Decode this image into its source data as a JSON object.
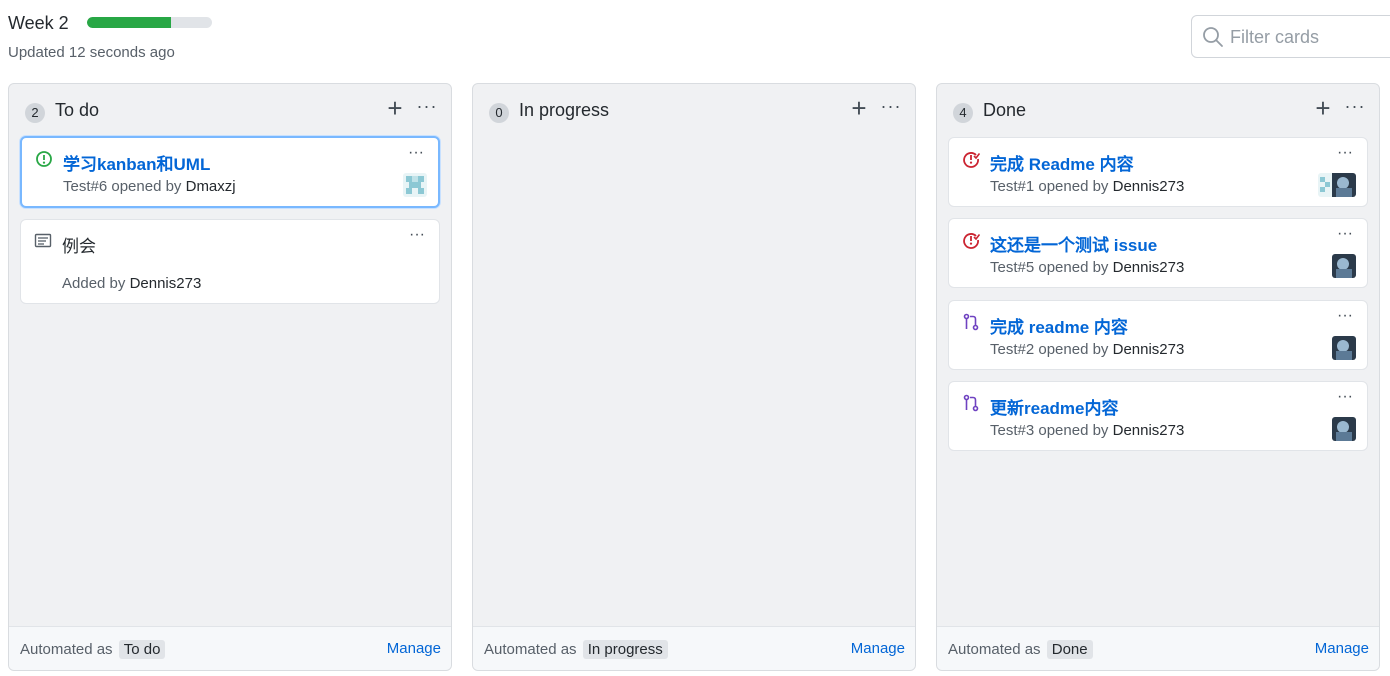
{
  "board": {
    "title": "Week 2",
    "progress": 0.67,
    "updated": "Updated 12 seconds ago",
    "filter_placeholder": "Filter cards"
  },
  "columns": [
    {
      "count": "2",
      "title": "To do",
      "automated_label": "Automated as",
      "automated_value": "To do",
      "manage": "Manage",
      "cards": [
        {
          "type": "issue-open",
          "title": "学习kanban和UML",
          "meta_prefix": "Test#6 opened by",
          "author": "Dmaxzj"
        },
        {
          "type": "note",
          "title": "例会",
          "meta_prefix": "Added by",
          "author": "Dennis273"
        }
      ]
    },
    {
      "count": "0",
      "title": "In progress",
      "automated_label": "Automated as",
      "automated_value": "In progress",
      "manage": "Manage",
      "cards": []
    },
    {
      "count": "4",
      "title": "Done",
      "automated_label": "Automated as",
      "automated_value": "Done",
      "manage": "Manage",
      "cards": [
        {
          "type": "issue-closed",
          "title": "完成 Readme 内容",
          "meta_prefix": "Test#1 opened by",
          "author": "Dennis273"
        },
        {
          "type": "issue-closed",
          "title": "这还是一个测试 issue",
          "meta_prefix": "Test#5 opened by",
          "author": "Dennis273"
        },
        {
          "type": "pr-merged",
          "title": "完成 readme 内容",
          "meta_prefix": "Test#2 opened by",
          "author": "Dennis273"
        },
        {
          "type": "pr-merged",
          "title": "更新readme内容",
          "meta_prefix": "Test#3 opened by",
          "author": "Dennis273"
        }
      ]
    }
  ],
  "colors": {
    "progress": "#28a745",
    "link": "#0366d6",
    "issue_open": "#28a745",
    "issue_closed": "#cb2431",
    "pr_merged": "#6f42c1"
  }
}
